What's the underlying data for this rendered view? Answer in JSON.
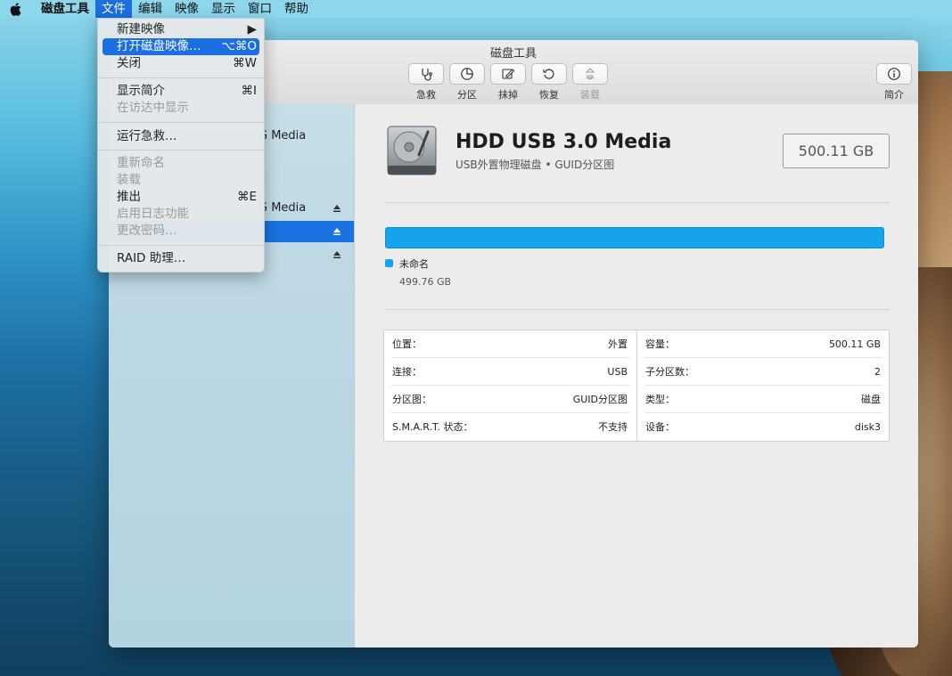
{
  "menubar": {
    "apple": "",
    "app_name": "磁盘工具",
    "items": [
      "文件",
      "编辑",
      "映像",
      "显示",
      "窗口",
      "帮助"
    ]
  },
  "window": {
    "title": "磁盘工具",
    "toolbar": {
      "first_aid": "急救",
      "partition": "分区",
      "erase": "抹掉",
      "restore": "恢复",
      "mount": "装载",
      "info": "简介"
    }
  },
  "sidebar": {
    "rows": [
      {
        "text": "G Media"
      },
      {
        "text": "G Media"
      },
      {
        "text": ""
      },
      {
        "text": ""
      }
    ]
  },
  "disk": {
    "name": "HDD USB 3.0 Media",
    "subtitle": "USB外置物理磁盘 • GUID分区图",
    "size": "500.11 GB"
  },
  "usage": {
    "volume_name": "未命名",
    "volume_size": "499.76 GB",
    "color": "#14a4ec"
  },
  "info": {
    "left": [
      {
        "k": "位置：",
        "v": "外置"
      },
      {
        "k": "连接：",
        "v": "USB"
      },
      {
        "k": "分区图：",
        "v": "GUID分区图"
      },
      {
        "k": "S.M.A.R.T. 状态：",
        "v": "不支持"
      }
    ],
    "right": [
      {
        "k": "容量：",
        "v": "500.11 GB"
      },
      {
        "k": "子分区数：",
        "v": "2"
      },
      {
        "k": "类型：",
        "v": "磁盘"
      },
      {
        "k": "设备：",
        "v": "disk3"
      }
    ]
  },
  "file_menu": {
    "new_image": "新建映像",
    "open_image": "打开磁盘映像…",
    "open_image_sc": "⌥⌘O",
    "close": "关闭",
    "close_sc": "⌘W",
    "get_info": "显示简介",
    "get_info_sc": "⌘I",
    "show_in_finder": "在访达中显示",
    "first_aid": "运行急救…",
    "rename": "重新命名",
    "mount": "装载",
    "eject": "推出",
    "eject_sc": "⌘E",
    "journaling": "启用日志功能",
    "change_password": "更改密码…",
    "raid": "RAID 助理…"
  }
}
